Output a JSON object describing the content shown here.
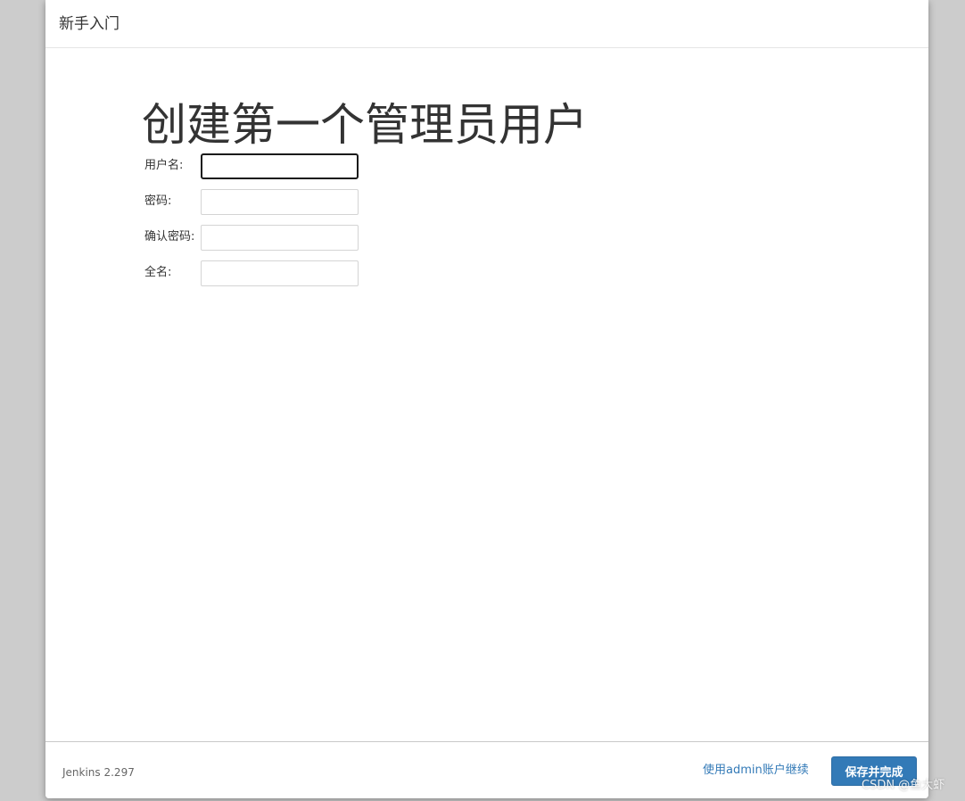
{
  "header": {
    "title": "新手入门"
  },
  "main": {
    "title": "创建第一个管理员用户",
    "fields": [
      {
        "label": "用户名:",
        "value": "",
        "focused": true
      },
      {
        "label": "密码:",
        "value": ""
      },
      {
        "label": "确认密码:",
        "value": ""
      },
      {
        "label": "全名:",
        "value": ""
      }
    ]
  },
  "footer": {
    "version": "Jenkins 2.297",
    "admin_link": "使用admin账户继续",
    "save_label": "保存并完成"
  },
  "watermark": "CSDN @鱼大虾",
  "colors": {
    "primary": "#337ab7",
    "backdrop": "#cccccc"
  }
}
